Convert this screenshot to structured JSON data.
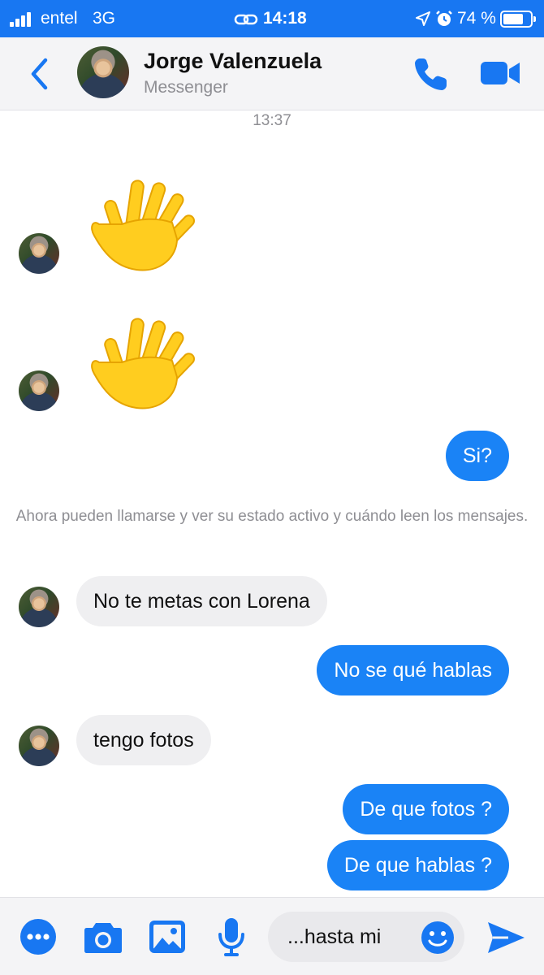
{
  "status_bar": {
    "carrier": "entel",
    "network": "3G",
    "time": "14:18",
    "battery_percent": "74 %",
    "battery_level": 0.74
  },
  "header": {
    "contact_name": "Jorge Valenzuela",
    "subtitle": "Messenger",
    "back_icon": "chevron-left-icon",
    "call_icon": "phone-icon",
    "video_icon": "video-camera-icon"
  },
  "conversation": {
    "timestamp": "13:37",
    "wave_emoji": "waving-hand",
    "outgoing_1": "Si?",
    "notice": "Ahora pueden llamarse y ver su estado activo y cuándo leen los mensajes.",
    "incoming_1": "No te metas con Lorena",
    "outgoing_2": "No se qué hablas",
    "incoming_2": "tengo fotos",
    "outgoing_3": "De que fotos ?",
    "outgoing_4": "De que hablas ?"
  },
  "composer": {
    "draft_text": "...hasta mi",
    "icons": [
      "more-icon",
      "camera-icon",
      "gallery-icon",
      "microphone-icon",
      "emoji-icon",
      "send-icon"
    ]
  },
  "colors": {
    "brand_blue": "#1877f2",
    "outgoing_bubble": "#1a83f6",
    "incoming_bubble": "#efeff1"
  }
}
